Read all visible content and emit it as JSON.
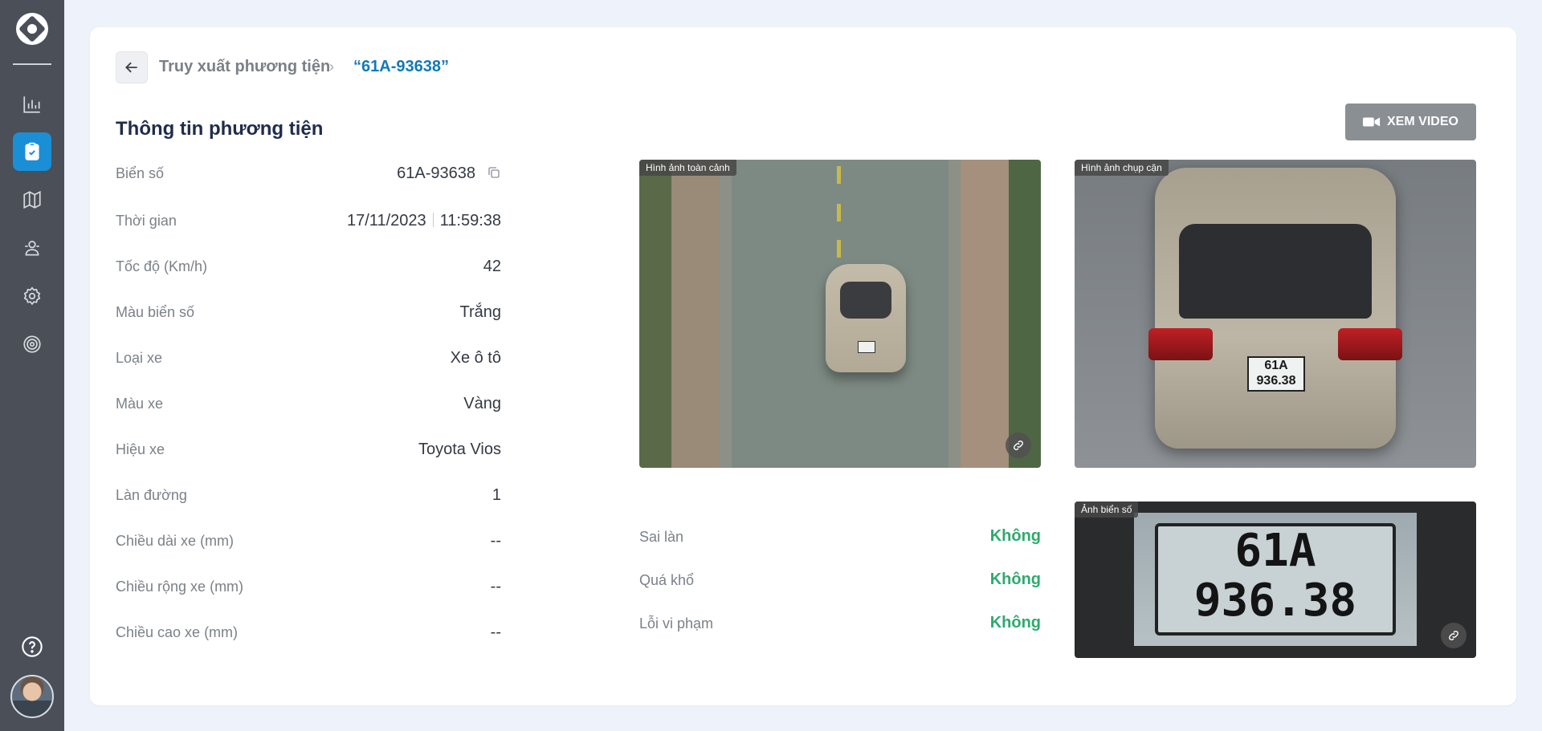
{
  "breadcrumb": {
    "parent": "Truy xuất phương tiện",
    "current": "“61A-93638”"
  },
  "section_title": "Thông tin phương tiện",
  "info": [
    {
      "label": "Biển số",
      "value": "61A-93638"
    },
    {
      "label": "Thời gian",
      "date": "17/11/2023",
      "time": "11:59:38"
    },
    {
      "label": "Tốc độ (Km/h)",
      "value": "42"
    },
    {
      "label": "Màu biển số",
      "value": "Trắng"
    },
    {
      "label": "Loại xe",
      "value": "Xe ô tô"
    },
    {
      "label": "Màu xe",
      "value": "Vàng"
    },
    {
      "label": "Hiệu xe",
      "value": "Toyota Vios"
    },
    {
      "label": "Làn đường",
      "value": "1"
    },
    {
      "label": "Chiều dài xe (mm)",
      "value": "--"
    },
    {
      "label": "Chiều rộng xe (mm)",
      "value": "--"
    },
    {
      "label": "Chiều cao xe (mm)",
      "value": "--"
    }
  ],
  "video_button": "XEM VIDEO",
  "photos": {
    "wide_label": "Hình ảnh toàn cảnh",
    "close_label": "Hình ảnh chụp cận",
    "plate_label": "Ảnh biển số",
    "plate_line1": "61A",
    "plate_line2": "936.38"
  },
  "violations": [
    {
      "label": "Sai làn",
      "value": "Không"
    },
    {
      "label": "Quá khổ",
      "value": "Không"
    },
    {
      "label": "Lỗi vi phạm",
      "value": "Không"
    }
  ],
  "colors": {
    "sidebar": "#4a4f58",
    "accent": "#1a8fd6",
    "link": "#137ab5",
    "ok": "#2eaa6e"
  },
  "icons": [
    "logo-icon",
    "chart-icon",
    "clipboard-check-icon",
    "map-icon",
    "users-icon",
    "gear-icon",
    "target-icon",
    "help-icon",
    "arrow-left-icon",
    "chevron-right-icon",
    "copy-icon",
    "video-camera-icon",
    "link-icon"
  ]
}
